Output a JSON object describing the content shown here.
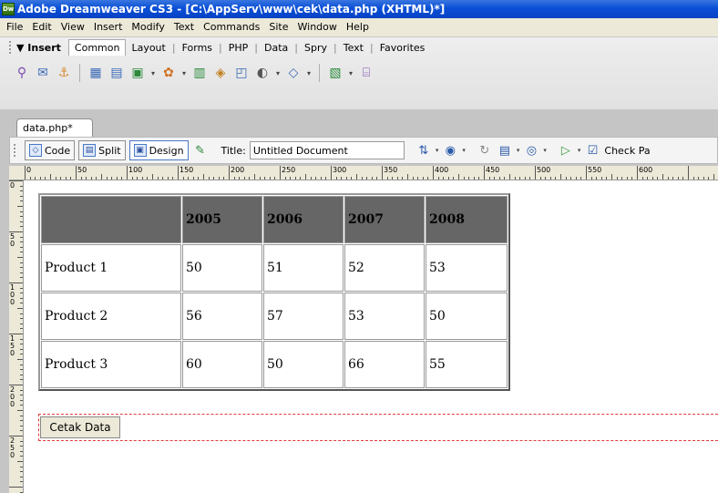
{
  "window": {
    "title": "Adobe Dreamweaver CS3 - [C:\\AppServ\\www\\cek\\data.php (XHTML)*]",
    "app_icon": "Dw"
  },
  "menu": [
    "File",
    "Edit",
    "View",
    "Insert",
    "Modify",
    "Text",
    "Commands",
    "Site",
    "Window",
    "Help"
  ],
  "insert_bar": {
    "label": "▼ Insert",
    "tabs": [
      "Common",
      "Layout",
      "Forms",
      "PHP",
      "Data",
      "Spry",
      "Text",
      "Favorites"
    ],
    "active_tab": "Common",
    "icons": [
      "hyperlink-icon",
      "email-link-icon",
      "named-anchor-icon",
      "table-icon",
      "div-icon",
      "images-icon",
      "media-icon",
      "date-icon",
      "server-side-include-icon",
      "comment-icon",
      "head-icon",
      "script-icon",
      "templates-icon",
      "tag-chooser-icon"
    ]
  },
  "document": {
    "tab_label": "data.php*",
    "views": {
      "code": "Code",
      "split": "Split",
      "design": "Design"
    },
    "title_label": "Title:",
    "title_value": "Untitled Document",
    "check_label": "Check Pa"
  },
  "ruler": {
    "top": [
      "0",
      "50",
      "100",
      "150",
      "200",
      "250",
      "300",
      "350",
      "400",
      "450",
      "500",
      "550",
      "600"
    ],
    "left": [
      "0",
      "5\n0",
      "1\n0\n0",
      "1\n5\n0",
      "2\n0\n0",
      "2\n5\n0"
    ]
  },
  "table": {
    "header": [
      "",
      "2005",
      "2006",
      "2007",
      "2008"
    ],
    "rows": [
      [
        "Product 1",
        "50",
        "51",
        "52",
        "53"
      ],
      [
        "Product 2",
        "56",
        "57",
        "53",
        "50"
      ],
      [
        "Product 3",
        "60",
        "50",
        "66",
        "55"
      ]
    ]
  },
  "form": {
    "button_label": "Cetak Data"
  }
}
